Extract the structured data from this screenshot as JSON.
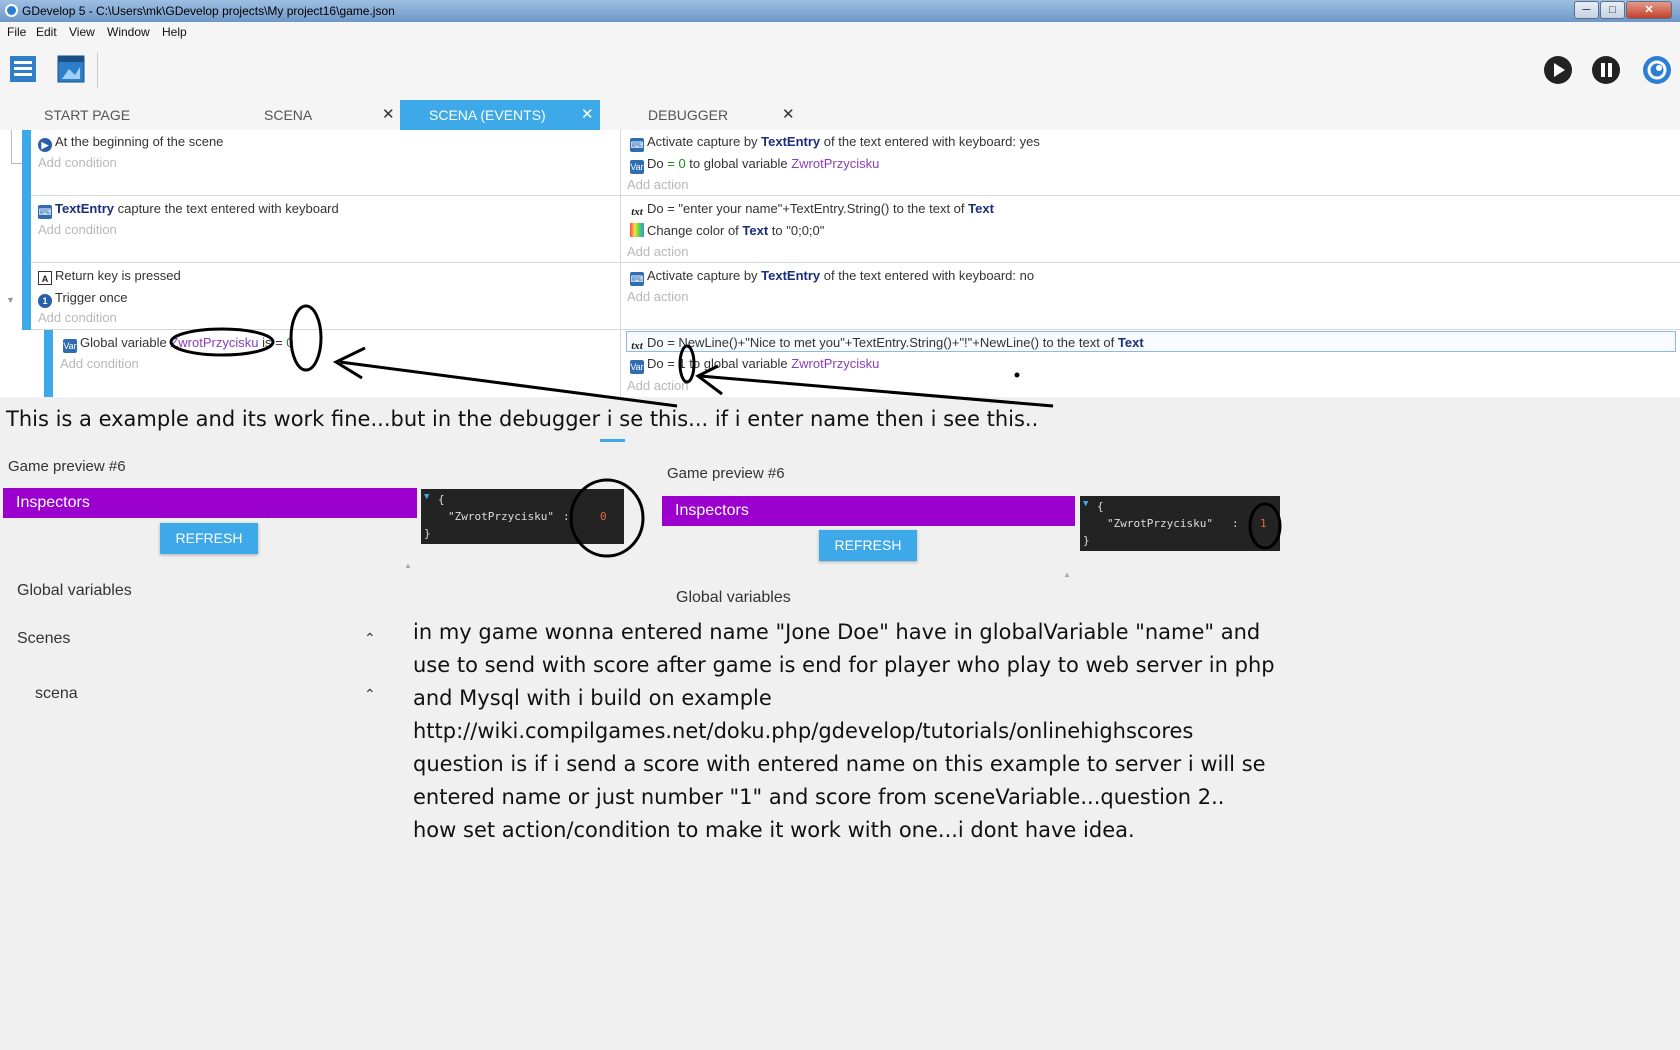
{
  "window": {
    "title": "GDevelop 5 - C:\\Users\\mk\\GDevelop projects\\My project16\\game.json",
    "controls": [
      "─",
      "□",
      "✕"
    ]
  },
  "menu": [
    "File",
    "Edit",
    "View",
    "Window",
    "Help"
  ],
  "tabs": [
    {
      "label": "START PAGE",
      "active": false,
      "closable": false
    },
    {
      "label": "SCENA",
      "active": false,
      "closable": true
    },
    {
      "label": "SCENA (EVENTS)",
      "active": true,
      "closable": true
    },
    {
      "label": "DEBUGGER",
      "active": false,
      "closable": true
    }
  ],
  "events": {
    "add_condition": "Add condition",
    "add_action": "Add action",
    "e1": {
      "condition": "At the beginning of the scene",
      "a1_pre": "Activate capture by ",
      "a1_obj": "TextEntry",
      "a1_post": " of the text entered with keyboard: yes",
      "a2_pre": "Do ",
      "a2_num": "= 0",
      "a2_mid": " to global variable ",
      "a2_var": "ZwrotPrzycisku"
    },
    "e2": {
      "cond_obj": "TextEntry",
      "cond_post": " capture the text entered with keyboard",
      "a1_pre": "Do = \"enter your name\"+TextEntry.String() to the text of ",
      "a1_obj": "Text",
      "a2_pre": "Change color of ",
      "a2_obj": "Text",
      "a2_post": " to \"0;0;0\""
    },
    "e3": {
      "cond1": "Return key is pressed",
      "cond2": "Trigger once",
      "a1_pre": "Activate capture by ",
      "a1_obj": "TextEntry",
      "a1_post": " of the text entered with keyboard: no"
    },
    "e4": {
      "cond_pre": "Global variable ",
      "cond_var": "ZwrotPrzycisku",
      "cond_post": " is = ",
      "cond_num": "0",
      "a1_pre": "Do = NewLine()+\"Nice to met you\"+TextEntry.String()+\"!\"+NewLine() to the text of ",
      "a1_obj": "Text",
      "a2_pre": "Do = 1 to global variable ",
      "a2_var": "ZwrotPrzycisku"
    }
  },
  "annotation_line": "This is a example and its work fine...but in the debugger i se this... if i enter name then i see this..",
  "debugger": [
    {
      "title": "Game preview #6",
      "inspectors": "Inspectors",
      "refresh": "REFRESH",
      "json_key": "\"ZwrotPrzycisku\"",
      "json_sep": " : ",
      "json_val": "0",
      "global_vars": "Global variables",
      "scenes": "Scenes",
      "scene_item": "scena"
    },
    {
      "title": "Game preview #6",
      "inspectors": "Inspectors",
      "refresh": "REFRESH",
      "json_key": "\"ZwrotPrzycisku\"",
      "json_sep": " : ",
      "json_val": "1",
      "global_vars": "Global variables"
    }
  ],
  "question_lines": [
    "in my game  wonna entered name \"Jone Doe\" have in globalVariable \"name\" and",
    "use to send with score after game is end for player who play to web server in php",
    "and Mysql with i build on example",
    "http://wiki.compilgames.net/doku.php/gdevelop/tutorials/onlinehighscores",
    "question is  if i send a score with entered name on this example to server i will se",
    "entered name or just number \"1\" and score  from sceneVariable...question 2..",
    "how set action/condition to make it work with one...i dont have idea."
  ],
  "json_brace_open": "{",
  "json_brace_close": "}",
  "colors": {
    "accent": "#3ea9e8",
    "inspectors": "#9b00cf",
    "object": "#1b2e7a",
    "variable": "#8a3fb8"
  }
}
